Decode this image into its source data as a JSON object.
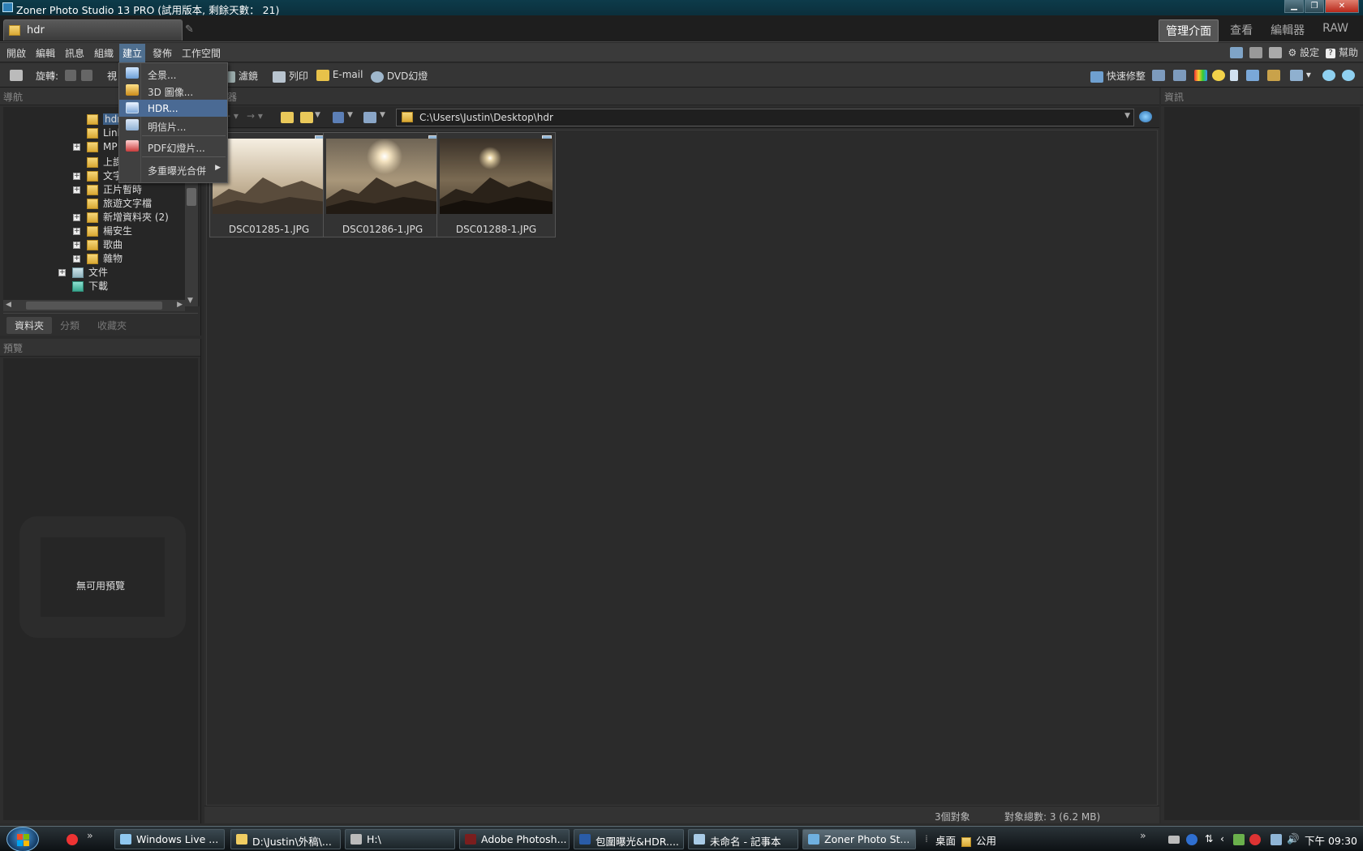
{
  "window": {
    "title": "Zoner Photo Studio 13 PRO (試用版本, 剩餘天數： 21)"
  },
  "doc_tab": {
    "label": "hdr"
  },
  "modes": [
    "管理介面",
    "查看",
    "編輯器",
    "RAW"
  ],
  "menubar": {
    "items": [
      "開啟",
      "編輯",
      "訊息",
      "組織",
      "建立",
      "發佈",
      "工作空間"
    ],
    "settings": "設定",
    "help": "幫助"
  },
  "toolbar": {
    "rotate_label": "旋轉:",
    "view_label": "視",
    "filter_label": "濾鏡",
    "print_label": "列印",
    "email_label": "E-mail",
    "dvd_label": "DVD幻燈",
    "quickfix_label": "快速修整"
  },
  "create_menu": {
    "items": [
      "全景...",
      "3D 圖像...",
      "HDR...",
      "明信片...",
      "PDF幻燈片...",
      "多重曝光合併"
    ]
  },
  "nav_panel": {
    "title": "導航",
    "tree": [
      {
        "label": "hdr"
      },
      {
        "label": "Link"
      },
      {
        "label": "MP"
      },
      {
        "label": "上課"
      },
      {
        "label": "文字"
      },
      {
        "label": "正片暫時"
      },
      {
        "label": "旅遊文字檔"
      },
      {
        "label": "新增資料夾 (2)"
      },
      {
        "label": "楊安生"
      },
      {
        "label": "歌曲"
      },
      {
        "label": "雜物"
      },
      {
        "label": "文件"
      },
      {
        "label": "下載"
      }
    ],
    "tabs": [
      "資料夾",
      "分類",
      "收藏夾"
    ]
  },
  "preview_panel": {
    "title": "預覽",
    "empty_text": "無可用預覽"
  },
  "browser": {
    "title": "瀏覽器",
    "path": "C:\\Users\\Justin\\Desktop\\hdr",
    "files": [
      {
        "name": "DSC01285-1.JPG"
      },
      {
        "name": "DSC01286-1.JPG"
      },
      {
        "name": "DSC01288-1.JPG"
      }
    ],
    "status_count": "3個對象",
    "status_total": "對象總數: 3 (6.2 MB)"
  },
  "info_panel": {
    "title": "資訊"
  },
  "taskbar": {
    "buttons": [
      {
        "label": "Windows Live ..."
      },
      {
        "label": "D:\\Justin\\外稿\\..."
      },
      {
        "label": "H:\\"
      },
      {
        "label": "Adobe Photosh..."
      },
      {
        "label": "包圍曝光&HDR...."
      },
      {
        "label": "未命名 - 記事本"
      },
      {
        "label": "Zoner Photo St..."
      }
    ],
    "desktop_label": "桌面",
    "public_label": "公用",
    "clock": "下午 09:30"
  }
}
